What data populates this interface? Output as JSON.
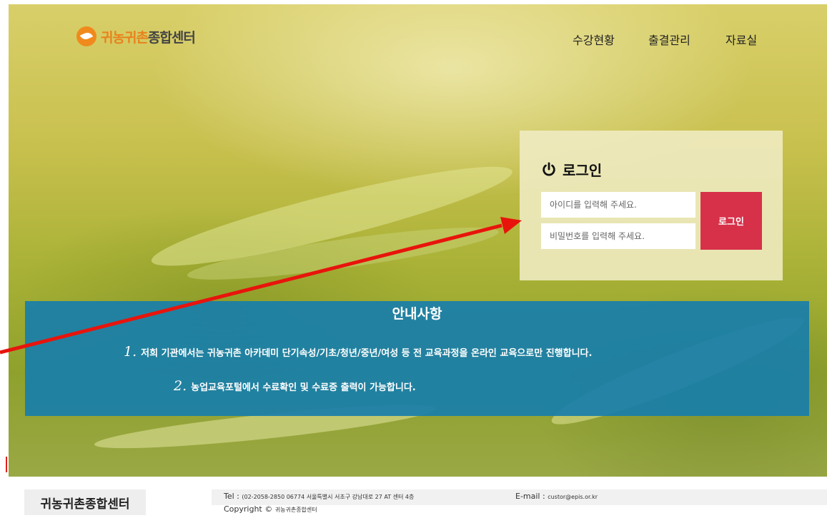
{
  "header": {
    "logo_part1": "귀농귀촌",
    "logo_part2": "종합센터",
    "nav": [
      "수강현황",
      "출결관리",
      "자료실"
    ]
  },
  "login": {
    "title": "로그인",
    "id_placeholder": "아이디를 입력해 주세요.",
    "pw_placeholder": "비밀번호를 입력해 주세요.",
    "button_label": "로그인"
  },
  "notice": {
    "title": "안내사항",
    "items": [
      {
        "num": "1.",
        "text": "저희 기관에서는 귀농귀촌 아카데미 단기속성/기초/청년/중년/여성 등 전 교육과정을 온라인 교육으로만 진행합니다."
      },
      {
        "num": "2.",
        "text": "농업교육포털에서 수료확인 및 수료증 출력이 가능합니다."
      }
    ]
  },
  "footer": {
    "name": "귀농귀촌종합센터",
    "tel_label": "Tel : ",
    "tel_value": "(02-2058-2850   06774 서울특별시 서초구 강남대로 27 AT 센터 4층",
    "email_label": "E-mail : ",
    "email_value": "custor@epis.or.kr",
    "copyright_label": "Copyright © ",
    "copyright_value": "귀농귀촌종합센터"
  },
  "colors": {
    "login_button": "#d7314a",
    "notice_bg": "#187eaa",
    "logo_orange": "#e8821c",
    "arrow": "#e8140c"
  },
  "icons": [
    "logo-leaf-icon",
    "power-icon",
    "annotation-arrow"
  ]
}
